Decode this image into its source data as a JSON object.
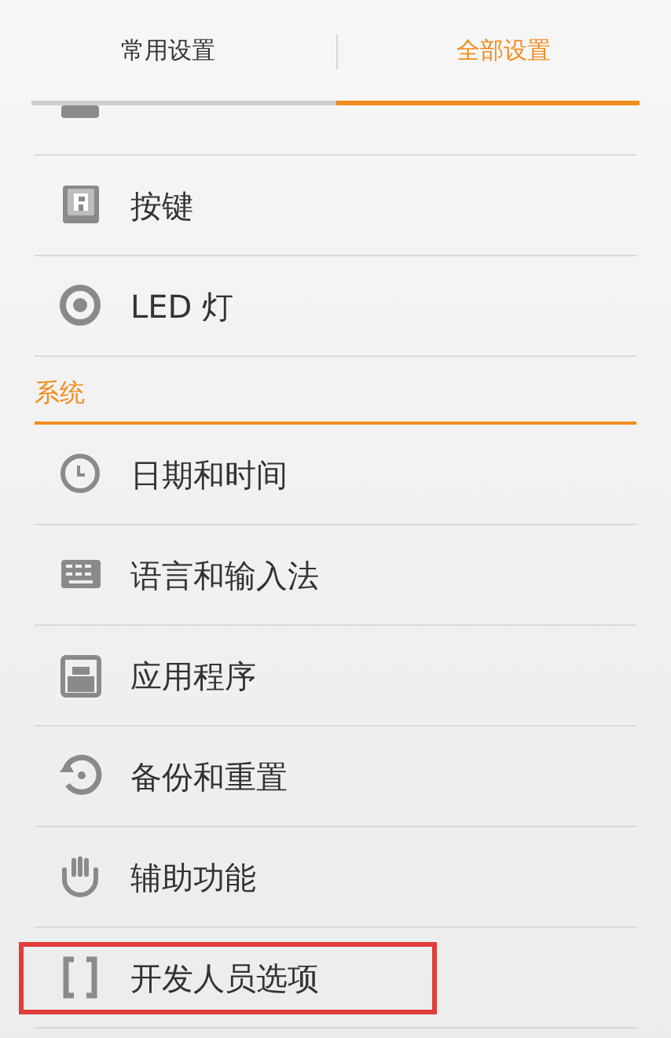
{
  "tabs": [
    {
      "label": "常用设置",
      "selected": false
    },
    {
      "label": "全部设置",
      "selected": true
    }
  ],
  "sections": [
    {
      "items": [
        {
          "highlighted": false
        },
        {
          "label": "按键",
          "highlighted": false
        },
        {
          "label": "LED 灯",
          "highlighted": false
        }
      ]
    },
    {
      "title": "系统",
      "items": [
        {
          "label": "日期和时间",
          "highlighted": false
        },
        {
          "label": "语言和输入法",
          "highlighted": false
        },
        {
          "label": "应用程序",
          "highlighted": false
        },
        {
          "label": "备份和重置",
          "highlighted": false
        },
        {
          "label": "辅助功能",
          "highlighted": false
        },
        {
          "label": "开发人员选项",
          "highlighted": true
        }
      ]
    }
  ]
}
